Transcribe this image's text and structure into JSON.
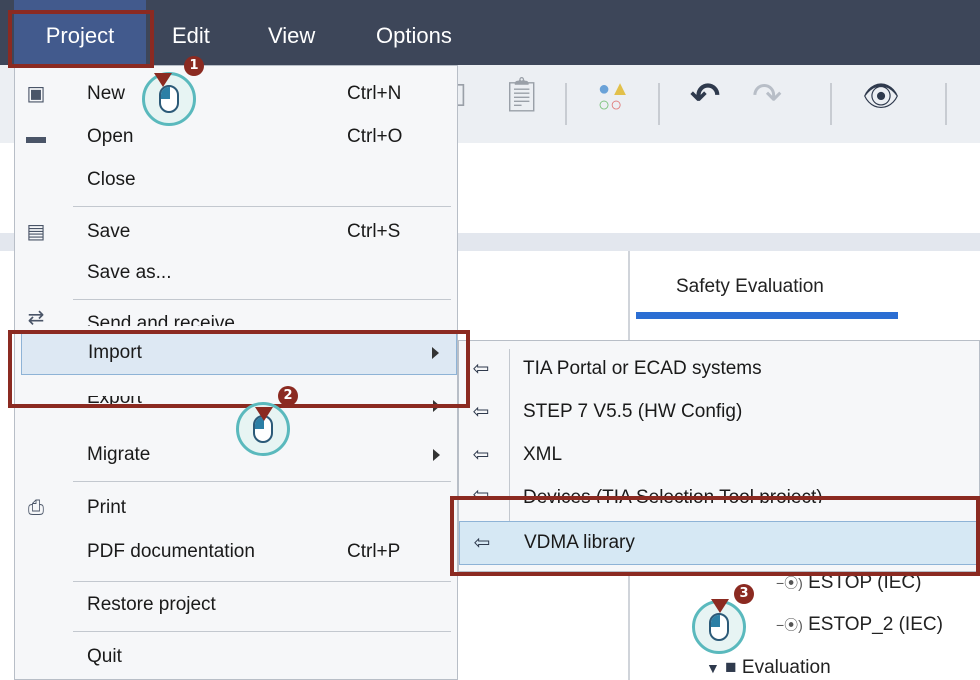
{
  "menubar": {
    "items": [
      "Project",
      "Edit",
      "View",
      "Options"
    ]
  },
  "background": {
    "tab_label": "Safety Evaluation",
    "tree_items": [
      "ESTOP (IEC)",
      "ESTOP_2 (IEC)",
      "Evaluation"
    ],
    "partial_labels": [
      "Send and receive",
      "Export",
      "Devices (TIA Selection Tool project)"
    ]
  },
  "project_menu": {
    "items": [
      {
        "label": "New",
        "shortcut": "Ctrl+N",
        "icon": "new-project-icon"
      },
      {
        "label": "Open",
        "shortcut": "Ctrl+O",
        "icon": "folder-open-icon"
      },
      {
        "label": "Close",
        "shortcut": "",
        "icon": ""
      },
      {
        "label": "Save",
        "shortcut": "Ctrl+S",
        "icon": "save-icon"
      },
      {
        "label": "Save as...",
        "shortcut": "",
        "icon": ""
      },
      {
        "label": "Import",
        "shortcut": "",
        "icon": "",
        "submenu": true,
        "highlighted": true
      },
      {
        "label": "Migrate",
        "shortcut": "",
        "icon": "",
        "submenu": true
      },
      {
        "label": "Print",
        "shortcut": "",
        "icon": "printer-icon"
      },
      {
        "label": "PDF documentation",
        "shortcut": "Ctrl+P",
        "icon": ""
      },
      {
        "label": "Restore project",
        "shortcut": "",
        "icon": ""
      },
      {
        "label": "Quit",
        "shortcut": "",
        "icon": ""
      }
    ]
  },
  "import_submenu": {
    "items": [
      {
        "label": "TIA Portal or ECAD systems",
        "icon": "import-icon"
      },
      {
        "label": "STEP 7 V5.5 (HW Config)",
        "icon": "import-icon"
      },
      {
        "label": "XML",
        "icon": "import-icon"
      },
      {
        "label": "VDMA library",
        "icon": "import-icon",
        "highlighted": true
      }
    ]
  },
  "callouts": [
    "1",
    "2",
    "3"
  ],
  "colors": {
    "menubar_bg": "#3d4659",
    "callout_red": "#8b2a21",
    "highlight_blue": "#d6e8f4",
    "badge_teal": "#5ab9bd",
    "tab_accent": "#2b6ed3"
  }
}
